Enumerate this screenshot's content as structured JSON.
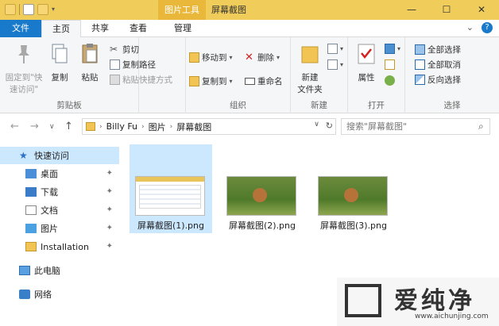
{
  "titlebar": {
    "context_tab": "图片工具",
    "title": "屏幕截图",
    "minimize": "—",
    "maximize": "☐",
    "close": "✕"
  },
  "tabs": {
    "file": "文件",
    "home": "主页",
    "share": "共享",
    "view": "查看",
    "manage": "管理",
    "expand": "⌄",
    "help": "?"
  },
  "ribbon": {
    "clipboard": {
      "label": "剪贴板",
      "pin": "固定到\"快速访问\"",
      "copy": "复制",
      "paste": "粘贴",
      "cut": "剪切",
      "copy_path": "复制路径",
      "paste_shortcut": "粘贴快捷方式"
    },
    "organize": {
      "label": "组织",
      "move_to": "移动到",
      "copy_to": "复制到",
      "delete": "删除",
      "rename": "重命名"
    },
    "new": {
      "label": "新建",
      "new_folder": "新建\n文件夹"
    },
    "open": {
      "label": "打开",
      "properties": "属性"
    },
    "select": {
      "label": "选择",
      "select_all": "全部选择",
      "select_none": "全部取消",
      "invert": "反向选择"
    }
  },
  "address": {
    "crumbs": [
      "Billy Fu",
      "图片",
      "屏幕截图"
    ],
    "search_placeholder": "搜索\"屏幕截图\""
  },
  "nav": {
    "quick_access": "快速访问",
    "items": [
      "桌面",
      "下载",
      "文档",
      "图片",
      "Installation"
    ],
    "this_pc": "此电脑",
    "network": "网络"
  },
  "files": [
    {
      "name": "屏幕截图(1).png",
      "selected": true
    },
    {
      "name": "屏幕截图(2).png",
      "selected": false
    },
    {
      "name": "屏幕截图(3).png",
      "selected": false
    }
  ],
  "watermark": {
    "text": "爱纯净",
    "url": "www.aichunjing.com"
  },
  "colors": {
    "titlebar": "#f0cd5a",
    "file_tab": "#1979ca",
    "selection": "#cce8ff"
  }
}
